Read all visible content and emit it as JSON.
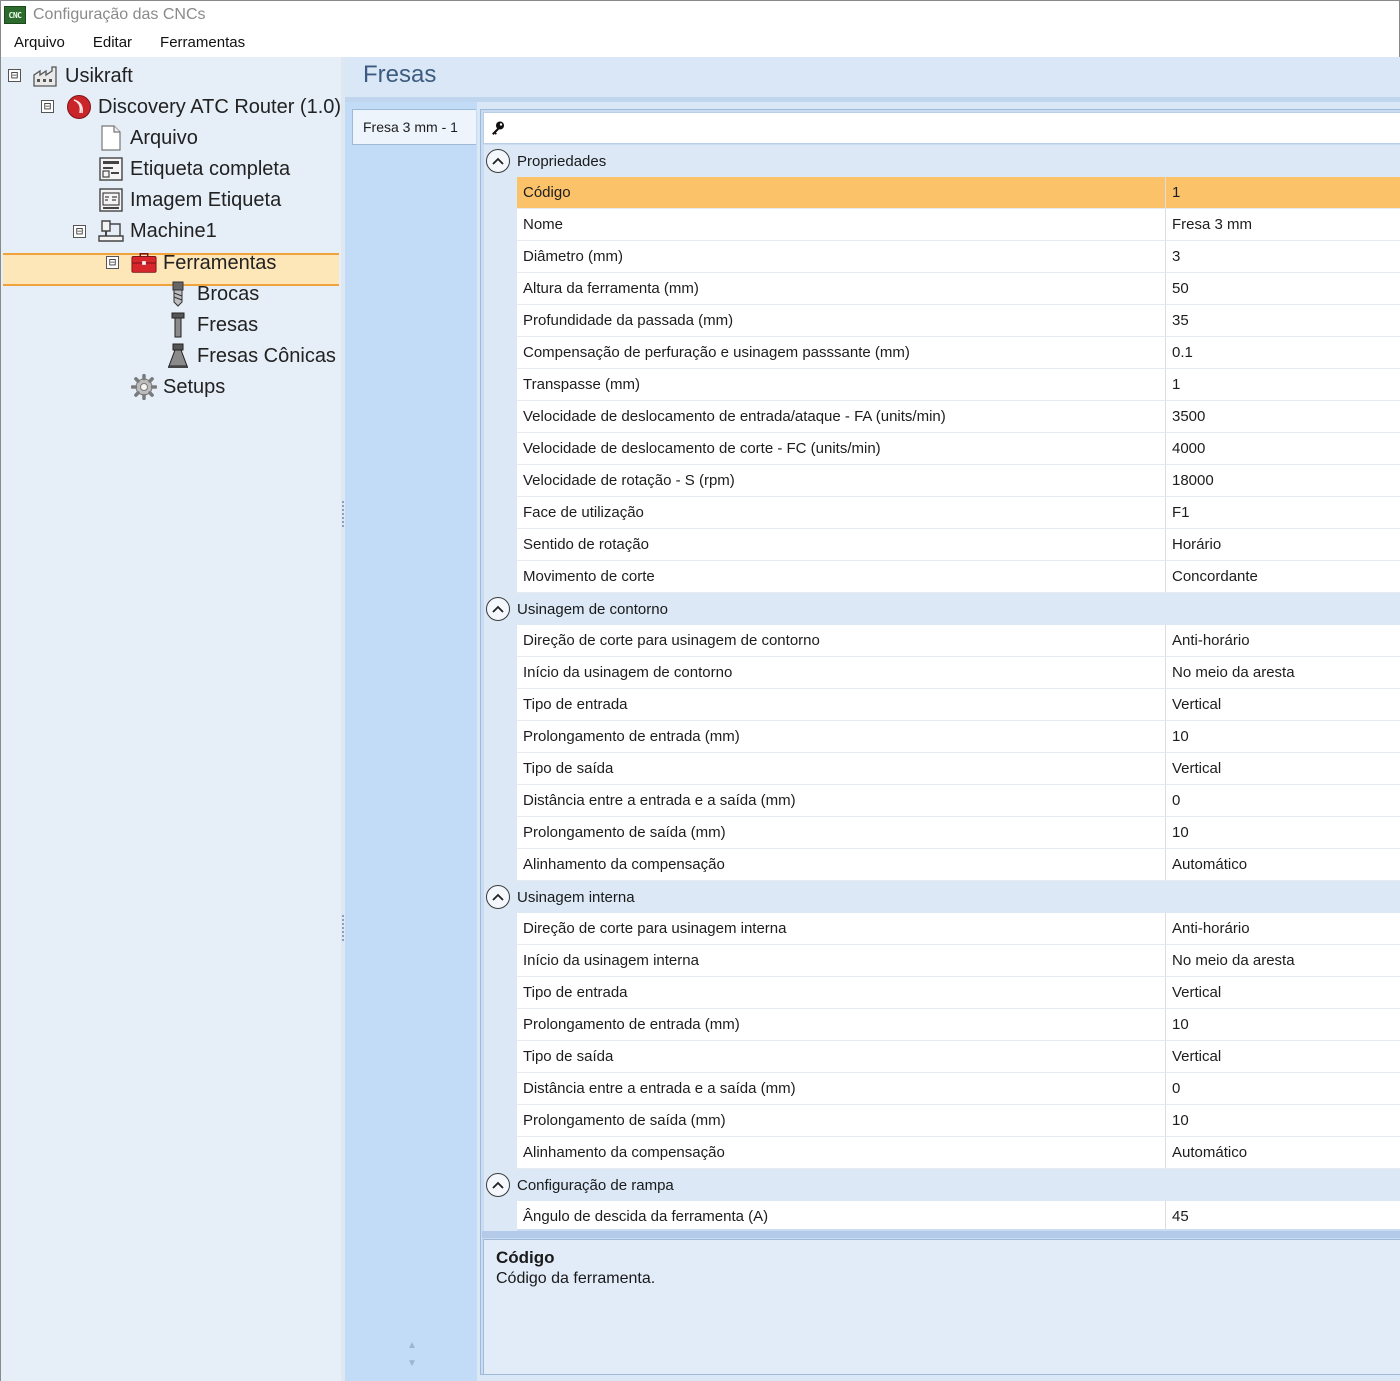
{
  "window": {
    "title": "Configuração das CNCs",
    "app_icon": "CNC"
  },
  "menu": [
    {
      "label": "Arquivo"
    },
    {
      "label": "Editar"
    },
    {
      "label": "Ferramentas"
    }
  ],
  "tree": {
    "selected": "Fresas",
    "nodes": [
      {
        "label": "Usikraft",
        "icon": "factory-icon",
        "expander": "⊟"
      },
      {
        "label": "Discovery ATC Router (1.0)",
        "icon": "router-icon",
        "expander": "⊟"
      },
      {
        "label": "Arquivo",
        "icon": "file-icon"
      },
      {
        "label": "Etiqueta completa",
        "icon": "label-icon"
      },
      {
        "label": "Imagem Etiqueta",
        "icon": "label-image-icon"
      },
      {
        "label": "Machine1",
        "icon": "machine-icon",
        "expander": "⊟"
      },
      {
        "label": "Ferramentas",
        "icon": "toolbox-icon",
        "expander": "⊟"
      },
      {
        "label": "Brocas",
        "icon": "drill-bit-icon"
      },
      {
        "label": "Fresas",
        "icon": "mill-bit-icon"
      },
      {
        "label": "Fresas Cônicas",
        "icon": "conical-mill-icon"
      },
      {
        "label": "Setups",
        "icon": "gear-icon"
      }
    ]
  },
  "panel": {
    "title": "Fresas",
    "tabs": [
      {
        "label": "Fresa 3 mm - 1"
      }
    ]
  },
  "grid": {
    "categories": [
      {
        "label": "Propriedades",
        "rows": [
          {
            "name": "Código",
            "value": "1",
            "selected": true
          },
          {
            "name": "Nome",
            "value": "Fresa 3 mm"
          },
          {
            "name": "Diâmetro (mm)",
            "value": "3"
          },
          {
            "name": "Altura da ferramenta (mm)",
            "value": "50"
          },
          {
            "name": "Profundidade da passada (mm)",
            "value": "35"
          },
          {
            "name": "Compensação de perfuração e usinagem passsante (mm)",
            "value": "0.1"
          },
          {
            "name": "Transpasse (mm)",
            "value": "1"
          },
          {
            "name": "Velocidade de deslocamento de entrada/ataque - FA (units/min)",
            "value": "3500"
          },
          {
            "name": "Velocidade de deslocamento de corte - FC (units/min)",
            "value": "4000"
          },
          {
            "name": "Velocidade de rotação - S (rpm)",
            "value": "18000"
          },
          {
            "name": "Face de utilização",
            "value": "F1"
          },
          {
            "name": "Sentido de rotação",
            "value": "Horário"
          },
          {
            "name": "Movimento de corte",
            "value": "Concordante"
          }
        ]
      },
      {
        "label": "Usinagem de contorno",
        "rows": [
          {
            "name": "Direção de corte para usinagem de contorno",
            "value": "Anti-horário"
          },
          {
            "name": "Início da usinagem de contorno",
            "value": "No meio da aresta"
          },
          {
            "name": "Tipo de entrada",
            "value": "Vertical"
          },
          {
            "name": "Prolongamento de entrada (mm)",
            "value": "10"
          },
          {
            "name": "Tipo de saída",
            "value": "Vertical"
          },
          {
            "name": "Distância entre a entrada e a saída (mm)",
            "value": "0"
          },
          {
            "name": "Prolongamento de saída (mm)",
            "value": "10"
          },
          {
            "name": "Alinhamento da compensação",
            "value": "Automático"
          }
        ]
      },
      {
        "label": "Usinagem interna",
        "rows": [
          {
            "name": "Direção de corte para usinagem interna",
            "value": "Anti-horário"
          },
          {
            "name": "Início da usinagem interna",
            "value": "No meio da aresta"
          },
          {
            "name": "Tipo de entrada",
            "value": "Vertical"
          },
          {
            "name": "Prolongamento de entrada (mm)",
            "value": "10"
          },
          {
            "name": "Tipo de saída",
            "value": "Vertical"
          },
          {
            "name": "Distância entre a entrada e a saída (mm)",
            "value": "0"
          },
          {
            "name": "Prolongamento de saída (mm)",
            "value": "10"
          },
          {
            "name": "Alinhamento da compensação",
            "value": "Automático"
          }
        ]
      },
      {
        "label": "Configuração de rampa",
        "rows": [
          {
            "name": "Ângulo de descida da ferramenta (A)",
            "value": "45"
          }
        ]
      }
    ]
  },
  "help": {
    "title": "Código",
    "description": "Código da ferramenta."
  },
  "colors": {
    "selection_fill": "#fbc26a",
    "selection_border": "#f0a33c",
    "panel_blue": "#d9e7f7",
    "title_text": "#3d5c80"
  }
}
